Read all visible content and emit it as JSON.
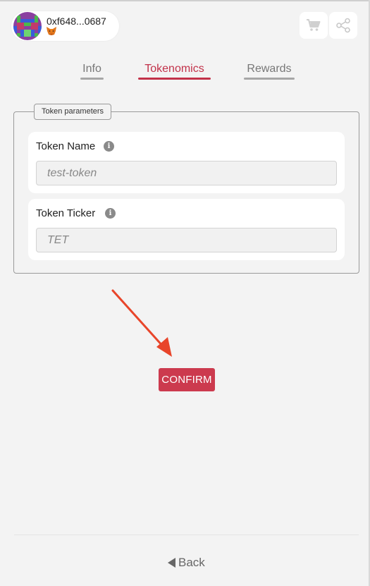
{
  "account": {
    "address": "0xf648...0687",
    "avatar_icon": "identicon-avatar",
    "wallet_icon": "metamask-fox-icon"
  },
  "header_actions": {
    "cart_icon": "cart-icon",
    "share_icon": "share-icon"
  },
  "tabs": [
    {
      "label": "Info",
      "active": false
    },
    {
      "label": "Tokenomics",
      "active": true
    },
    {
      "label": "Rewards",
      "active": false
    }
  ],
  "token_parameters": {
    "legend": "Token parameters",
    "fields": [
      {
        "label": "Token Name",
        "placeholder": "test-token",
        "value": ""
      },
      {
        "label": "Token Ticker",
        "placeholder": "",
        "value": "TET"
      }
    ]
  },
  "confirm_label": "CONFIRM",
  "back_label": "Back",
  "colors": {
    "accent": "#c2324a",
    "confirm_bg": "#cc3a4e",
    "arrow": "#e8452a",
    "background": "#f3f3f3"
  }
}
